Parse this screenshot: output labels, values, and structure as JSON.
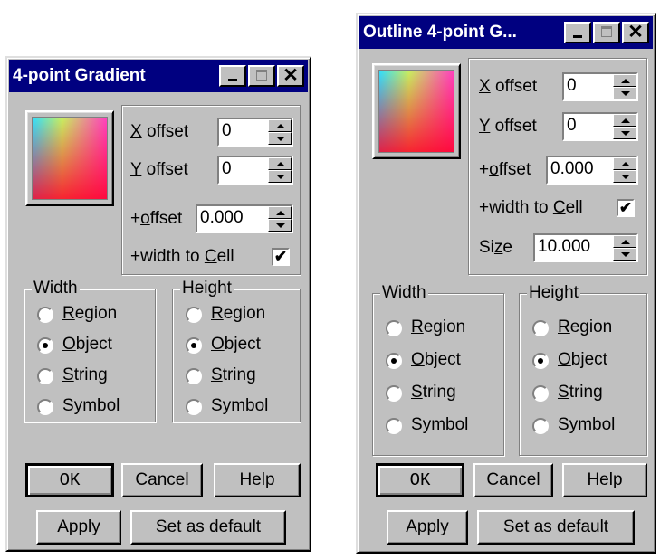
{
  "dialogs": [
    {
      "title": "4-point Gradient",
      "x_offset": {
        "label_key": "X",
        "label_rest": " offset",
        "value": "0"
      },
      "y_offset": {
        "label_key": "Y",
        "label_rest": " offset",
        "value": "0"
      },
      "plus_offset": {
        "label_pre": "+",
        "label_key": "o",
        "label_rest": "ffset",
        "value": "0.000"
      },
      "width_to_cell": {
        "label_pre": "+width to ",
        "label_key": "C",
        "label_rest": "ell",
        "checked": "✔"
      },
      "width_group": {
        "legend": "Width",
        "options": [
          "Region",
          "Object",
          "String",
          "Symbol"
        ],
        "selected": "Object"
      },
      "height_group": {
        "legend": "Height",
        "options": [
          "Region",
          "Object",
          "String",
          "Symbol"
        ],
        "selected": "Object"
      },
      "buttons": {
        "ok": "OK",
        "cancel": "Cancel",
        "help": "Help",
        "apply": "Apply",
        "set_default": "Set as default"
      }
    },
    {
      "title": "Outline 4-point G...",
      "x_offset": {
        "label_key": "X",
        "label_rest": " offset",
        "value": "0"
      },
      "y_offset": {
        "label_key": "Y",
        "label_rest": " offset",
        "value": "0"
      },
      "plus_offset": {
        "label_pre": "+",
        "label_key": "o",
        "label_rest": "ffset",
        "value": "0.000"
      },
      "width_to_cell": {
        "label_pre": "+width to ",
        "label_key": "C",
        "label_rest": "ell",
        "checked": "✔"
      },
      "size": {
        "label_pre": "Si",
        "label_key": "z",
        "label_rest": "e",
        "value": "10.000"
      },
      "width_group": {
        "legend": "Width",
        "options": [
          "Region",
          "Object",
          "String",
          "Symbol"
        ],
        "selected": "Object"
      },
      "height_group": {
        "legend": "Height",
        "options": [
          "Region",
          "Object",
          "String",
          "Symbol"
        ],
        "selected": "Object"
      },
      "buttons": {
        "ok": "OK",
        "cancel": "Cancel",
        "help": "Help",
        "apply": "Apply",
        "set_default": "Set as default"
      }
    }
  ],
  "icons": {
    "minimize": "minimize-icon",
    "maximize": "maximize-icon",
    "close": "close-icon",
    "close_glyph": "✕"
  }
}
